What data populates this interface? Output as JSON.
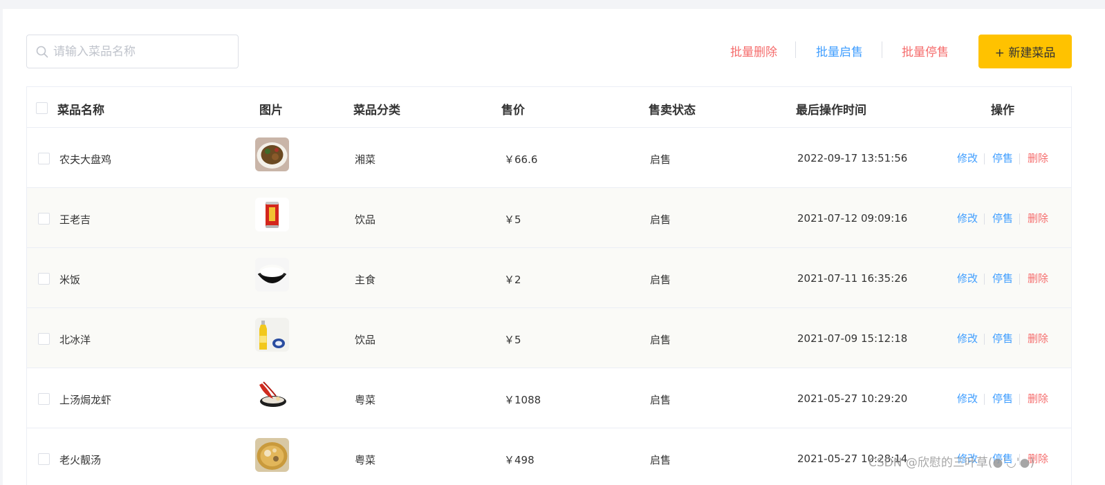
{
  "search": {
    "placeholder": "请输入菜品名称",
    "value": ""
  },
  "toolbar": {
    "batch_delete": "批量删除",
    "batch_enable": "批量启售",
    "batch_disable": "批量停售",
    "new_dish": "+ 新建菜品"
  },
  "table": {
    "columns": [
      "菜品名称",
      "图片",
      "菜品分类",
      "售价",
      "售卖状态",
      "最后操作时间",
      "操作"
    ],
    "rows": [
      {
        "name": "农夫大盘鸡",
        "category": "湘菜",
        "price": "￥66.6",
        "status": "启售",
        "time": "2022-09-17 13:51:56",
        "image": "dapanji-photo"
      },
      {
        "name": "王老吉",
        "category": "饮品",
        "price": "￥5",
        "status": "启售",
        "time": "2021-07-12 09:09:16",
        "image": "wanglaoji-can-photo"
      },
      {
        "name": "米饭",
        "category": "主食",
        "price": "￥2",
        "status": "启售",
        "time": "2021-07-11 16:35:26",
        "image": "rice-bowl-photo"
      },
      {
        "name": "北冰洋",
        "category": "饮品",
        "price": "￥5",
        "status": "启售",
        "time": "2021-07-09 15:12:18",
        "image": "beibingyang-bottle-photo"
      },
      {
        "name": "上汤焗龙虾",
        "category": "粤菜",
        "price": "￥1088",
        "status": "启售",
        "time": "2021-05-27 10:29:20",
        "image": "lobster-photo"
      },
      {
        "name": "老火靓汤",
        "category": "粤菜",
        "price": "￥498",
        "status": "启售",
        "time": "2021-05-27 10:28:14",
        "image": "soup-photo"
      }
    ],
    "actions": {
      "edit": "修改",
      "disable": "停售",
      "delete": "删除"
    }
  },
  "watermark": "CSDN @欣慰的三叶草(●'◡'●)",
  "colors": {
    "accent_yellow": "#ffc200",
    "link_blue": "#409eff",
    "danger_red": "#f56c6c"
  }
}
